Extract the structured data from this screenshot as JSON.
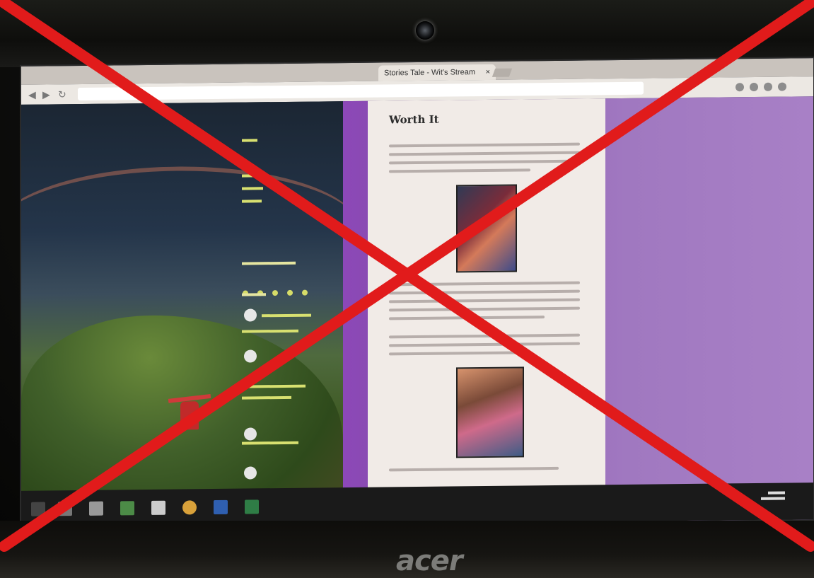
{
  "browser": {
    "tab_title": "Stories Tale - Wit's Stream",
    "tab_close": "×"
  },
  "blog": {
    "post_title": "Worth It"
  },
  "laptop": {
    "brand": "acer"
  },
  "colors": {
    "overlay_red": "#e11b1b",
    "page_bg": "#f1ebe7",
    "purple_bg": "#8c48b8",
    "sidebar_link": "#d8e070"
  },
  "icons": [
    "windows-start-icon",
    "file-explorer-icon",
    "calculator-icon",
    "app-icon",
    "file-icon",
    "chrome-icon",
    "word-icon",
    "excel-icon",
    "webcam-icon",
    "back-icon",
    "forward-icon",
    "reload-icon"
  ]
}
